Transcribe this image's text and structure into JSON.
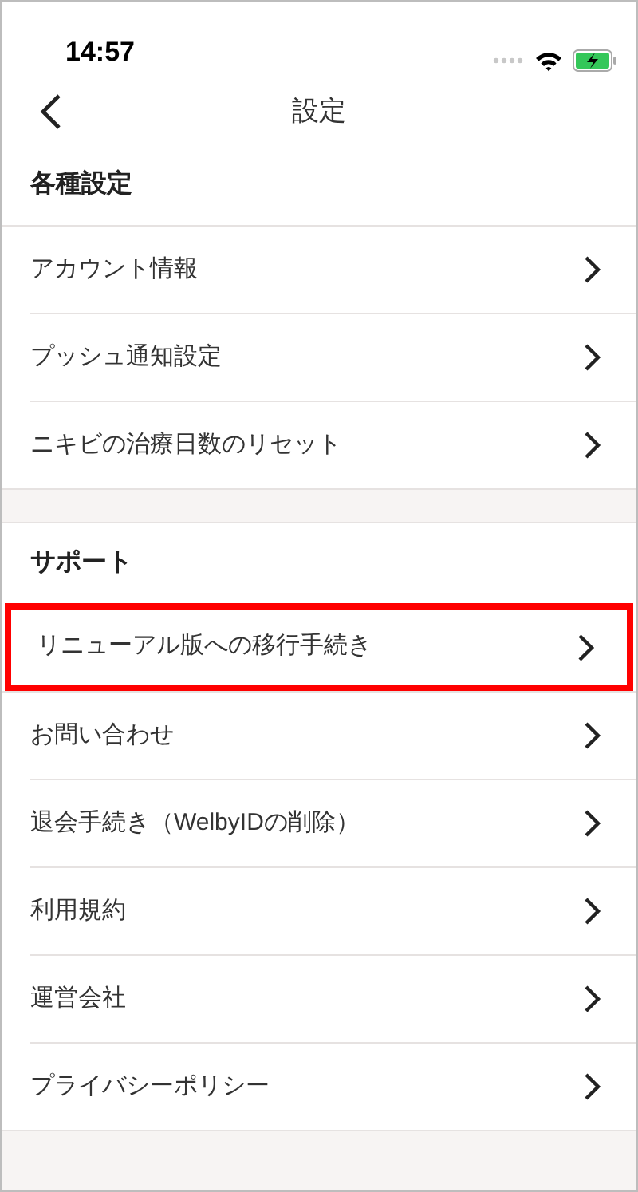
{
  "status_bar": {
    "time": "14:57"
  },
  "nav": {
    "title": "設定"
  },
  "sections": [
    {
      "title": "各種設定",
      "items": [
        {
          "label": "アカウント情報",
          "highlighted": false
        },
        {
          "label": "プッシュ通知設定",
          "highlighted": false
        },
        {
          "label": "ニキビの治療日数のリセット",
          "highlighted": false
        }
      ]
    },
    {
      "title": "サポート",
      "items": [
        {
          "label": "リニューアル版への移行手続き",
          "highlighted": true
        },
        {
          "label": "お問い合わせ",
          "highlighted": false
        },
        {
          "label": "退会手続き（WelbyIDの削除）",
          "highlighted": false
        },
        {
          "label": "利用規約",
          "highlighted": false
        },
        {
          "label": "運営会社",
          "highlighted": false
        },
        {
          "label": "プライバシーポリシー",
          "highlighted": false
        }
      ]
    }
  ]
}
